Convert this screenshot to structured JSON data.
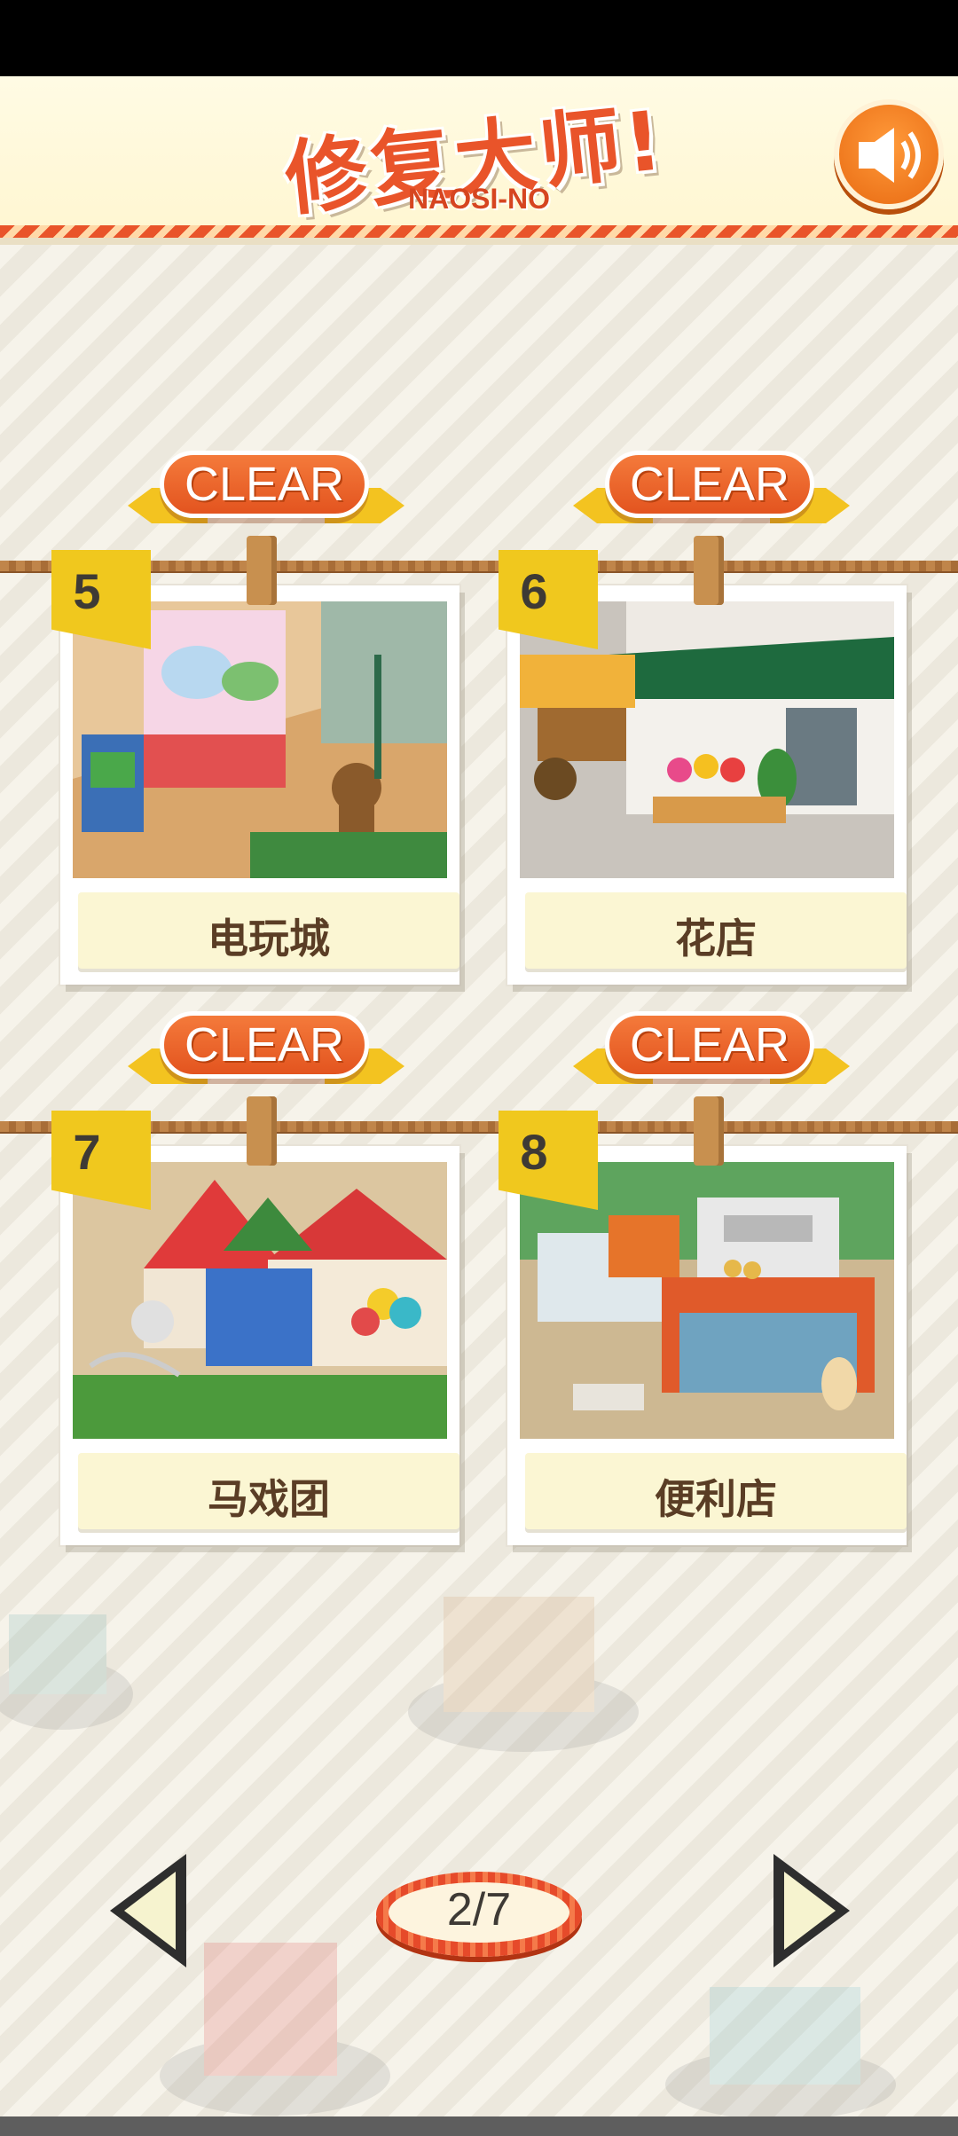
{
  "header": {
    "title": "修复大师!",
    "subtitle": "NAOSI-NO",
    "sound_icon": "speaker-icon"
  },
  "levels": [
    {
      "number": "5",
      "name": "电玩城",
      "status": "CLEAR"
    },
    {
      "number": "6",
      "name": "花店",
      "status": "CLEAR"
    },
    {
      "number": "7",
      "name": "马戏团",
      "status": "CLEAR"
    },
    {
      "number": "8",
      "name": "便利店",
      "status": "CLEAR"
    }
  ],
  "pagination": {
    "page_label": "2/7",
    "prev_icon": "triangle-left-icon",
    "next_icon": "triangle-right-icon"
  },
  "colors": {
    "accent_orange": "#e9542a",
    "flag_yellow": "#f0c81e",
    "label_brown": "#5a3d25"
  }
}
